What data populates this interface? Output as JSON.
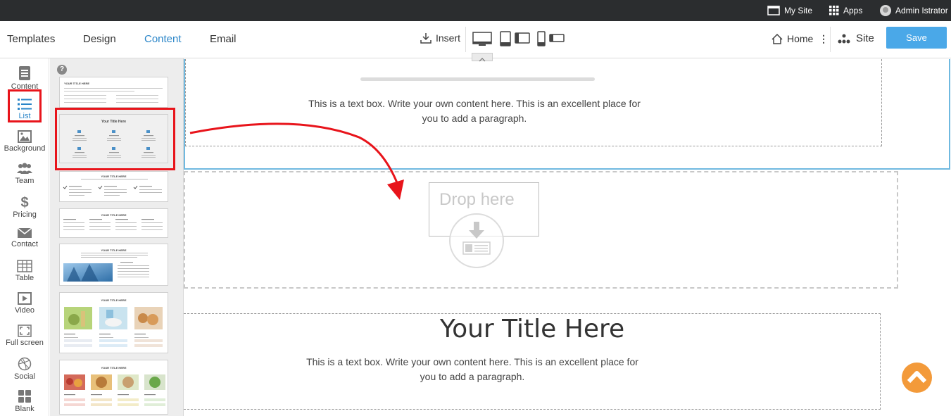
{
  "topbar": {
    "my_site": "My Site",
    "apps": "Apps",
    "user": "Admin Istrator"
  },
  "nav": {
    "tabs": [
      "Templates",
      "Design",
      "Content",
      "Email"
    ],
    "active_tab": "Content",
    "insert": "Insert",
    "home": "Home",
    "site": "Site",
    "save": "Save"
  },
  "sidebar": {
    "items": [
      {
        "label": "Content",
        "icon": "document-icon"
      },
      {
        "label": "List",
        "icon": "list-icon"
      },
      {
        "label": "Background",
        "icon": "image-icon"
      },
      {
        "label": "Team",
        "icon": "team-icon"
      },
      {
        "label": "Pricing",
        "icon": "dollar-icon"
      },
      {
        "label": "Contact",
        "icon": "envelope-icon"
      },
      {
        "label": "Table",
        "icon": "table-icon"
      },
      {
        "label": "Video",
        "icon": "play-icon"
      },
      {
        "label": "Full screen",
        "icon": "fullscreen-icon"
      },
      {
        "label": "Social",
        "icon": "dribbble-icon"
      },
      {
        "label": "Blank",
        "icon": "grid-icon"
      }
    ],
    "active": "List"
  },
  "panel": {
    "thumbs": [
      {
        "title": "YOUR TITLE HERE"
      },
      {
        "title": "Your Title Here"
      },
      {
        "title": "YOUR TITLE HERE"
      },
      {
        "title": "YOUR TITLE HERE"
      },
      {
        "title": "YOUR TITLE HERE"
      },
      {
        "title": "YOUR TITLE HERE"
      },
      {
        "title": "YOUR TITLE HERE"
      }
    ]
  },
  "canvas": {
    "para1": "This is a text box. Write your own content here. This is an excellent place for you to add a paragraph.",
    "drop_here": "Drop here",
    "title": "Your Title Here",
    "para2": "This is a text box. Write your own content here. This is an excellent place for you to add a paragraph."
  },
  "colors": {
    "accent": "#2a85c8",
    "save_button": "#4aa8e8",
    "highlight": "#e8141b",
    "scroll_top": "#f39a3a",
    "topbar": "#2b2d2f"
  }
}
